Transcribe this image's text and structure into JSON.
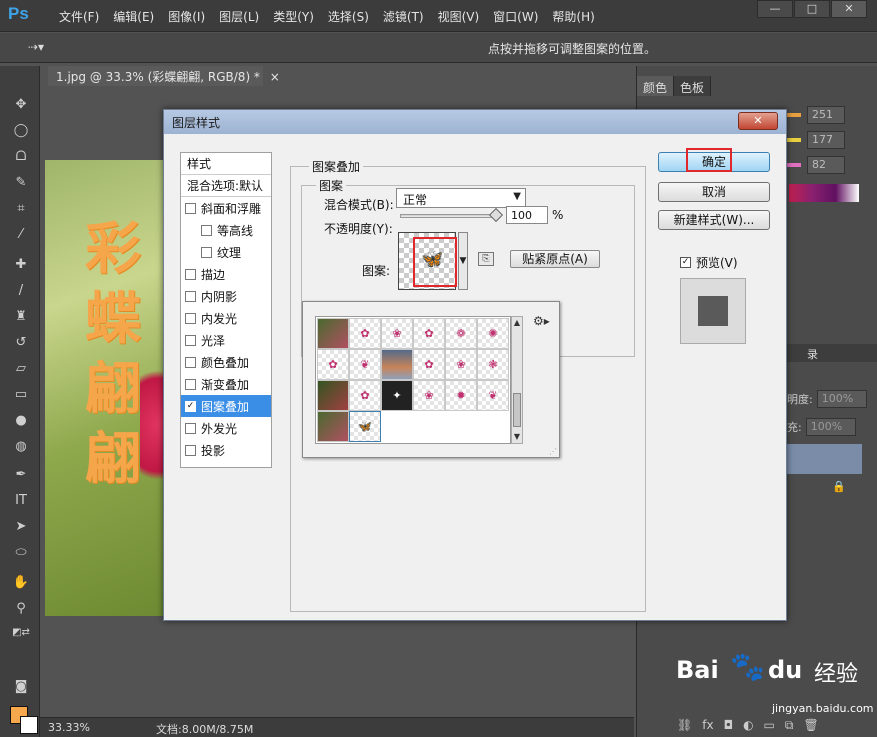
{
  "app": {
    "logo": "Ps",
    "menu": [
      "文件(F)",
      "编辑(E)",
      "图像(I)",
      "图层(L)",
      "类型(Y)",
      "选择(S)",
      "滤镜(T)",
      "视图(V)",
      "窗口(W)",
      "帮助(H)"
    ],
    "window_controls": [
      "—",
      "□",
      "✕"
    ]
  },
  "options_bar": {
    "tool_icon": "move-tool-icon",
    "hint": "点按并拖移可调整图案的位置。"
  },
  "document": {
    "tab_label": "1.jpg @ 33.3% (彩蝶翩翩, RGB/8) *",
    "tab_close": "×",
    "canvas_text": [
      "彩",
      "蝶",
      "翩",
      "翩"
    ]
  },
  "status": {
    "zoom": "33.33%",
    "doc_info": "文档:8.00M/8.75M"
  },
  "right_panel": {
    "tabs": [
      "颜色",
      "色板"
    ],
    "rgb_values": [
      "251",
      "177",
      "82"
    ],
    "layers_tab": "录",
    "opacity_label": "明度:",
    "opacity_value": "100%",
    "fill_label": "充:",
    "fill_value": "100%"
  },
  "dialog": {
    "title": "图层样式",
    "close": "✕",
    "style_list": {
      "header": "样式",
      "blend_options": "混合选项:默认",
      "items": [
        {
          "label": "斜面和浮雕",
          "checked": false,
          "indent": false
        },
        {
          "label": "等高线",
          "checked": false,
          "indent": true
        },
        {
          "label": "纹理",
          "checked": false,
          "indent": true
        },
        {
          "label": "描边",
          "checked": false,
          "indent": false
        },
        {
          "label": "内阴影",
          "checked": false,
          "indent": false
        },
        {
          "label": "内发光",
          "checked": false,
          "indent": false
        },
        {
          "label": "光泽",
          "checked": false,
          "indent": false
        },
        {
          "label": "颜色叠加",
          "checked": false,
          "indent": false
        },
        {
          "label": "渐变叠加",
          "checked": false,
          "indent": false
        },
        {
          "label": "图案叠加",
          "checked": true,
          "indent": false,
          "selected": true
        },
        {
          "label": "外发光",
          "checked": false,
          "indent": false
        },
        {
          "label": "投影",
          "checked": false,
          "indent": false
        }
      ]
    },
    "pattern_overlay": {
      "group_title": "图案叠加",
      "sub_group_title": "图案",
      "blend_mode_label": "混合模式(B):",
      "blend_mode_value": "正常",
      "opacity_label": "不透明度(Y):",
      "opacity_value": "100",
      "opacity_unit": "%",
      "opacity_fraction": 1.0,
      "pattern_label": "图案:",
      "snap_button": "贴紧原点(A)"
    },
    "buttons": {
      "ok": "确定",
      "cancel": "取消",
      "new_style": "新建样式(W)...",
      "preview_label": "预览(V)",
      "preview_checked": true
    }
  },
  "pattern_picker": {
    "cells": [
      {
        "kind": "photo1",
        "glyph": ""
      },
      {
        "kind": "transparent",
        "glyph": "✿"
      },
      {
        "kind": "transparent",
        "glyph": "❀"
      },
      {
        "kind": "transparent",
        "glyph": "✿"
      },
      {
        "kind": "transparent",
        "glyph": "❁"
      },
      {
        "kind": "transparent",
        "glyph": "✺"
      },
      {
        "kind": "transparent",
        "glyph": "✿"
      },
      {
        "kind": "transparent",
        "glyph": "❦"
      },
      {
        "kind": "photo2",
        "glyph": ""
      },
      {
        "kind": "transparent",
        "glyph": "✿"
      },
      {
        "kind": "transparent",
        "glyph": "❀"
      },
      {
        "kind": "transparent",
        "glyph": "❃"
      },
      {
        "kind": "photo3",
        "glyph": ""
      },
      {
        "kind": "transparent",
        "glyph": "✿"
      },
      {
        "kind": "dark",
        "glyph": "✦"
      },
      {
        "kind": "transparent",
        "glyph": "❀"
      },
      {
        "kind": "transparent",
        "glyph": "✹"
      },
      {
        "kind": "transparent",
        "glyph": "❦"
      },
      {
        "kind": "photo1",
        "glyph": ""
      },
      {
        "kind": "transparent",
        "glyph": "🦋",
        "selected": true
      }
    ],
    "gear": "⚙▸"
  },
  "watermark": {
    "bai": "Bai",
    "du": "du",
    "cn": "经验",
    "url": "jingyan.baidu.com"
  },
  "colors": {
    "accent": "#3a8ee6",
    "highlight_red": "#e0282c",
    "canvas_text": "#f5a64b"
  }
}
